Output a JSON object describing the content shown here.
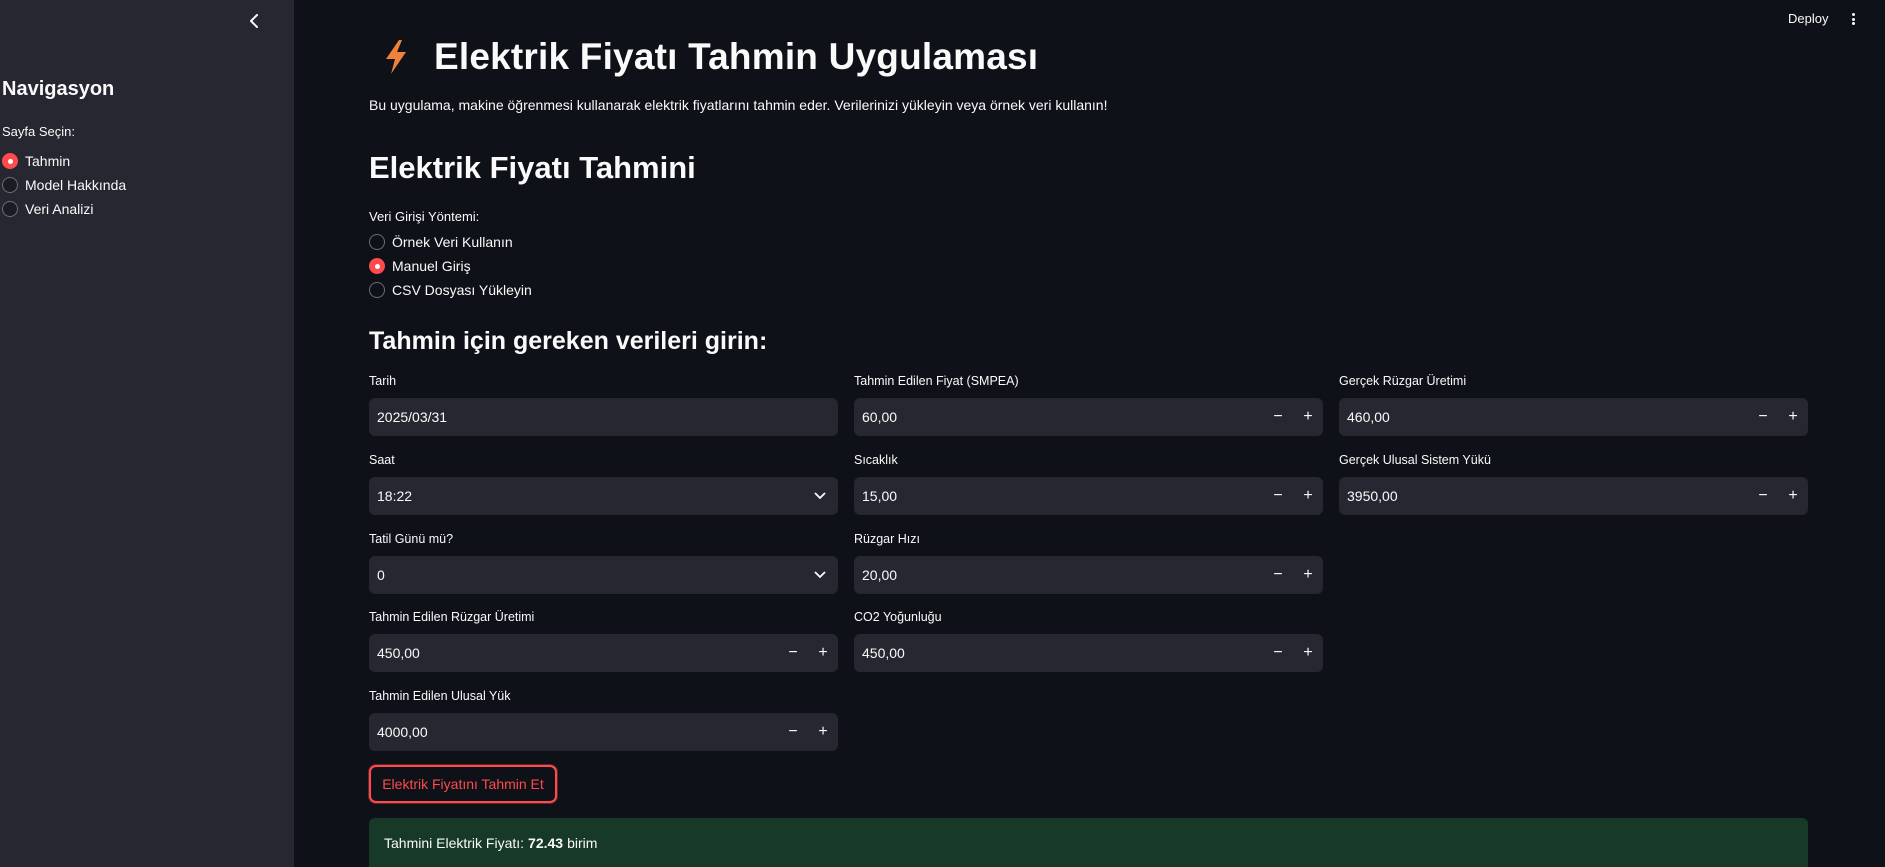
{
  "header": {
    "deploy_label": "Deploy",
    "menu_icon": "kebab-menu-icon"
  },
  "sidebar": {
    "title": "Navigasyon",
    "page_label": "Sayfa Seçin:",
    "items": [
      {
        "label": "Tahmin",
        "selected": true
      },
      {
        "label": "Model Hakkında",
        "selected": false
      },
      {
        "label": "Veri Analizi",
        "selected": false
      }
    ]
  },
  "main": {
    "title": "Elektrik Fiyatı Tahmin Uygulaması",
    "title_icon": "lightning-bolt-icon",
    "intro": "Bu uygulama, makine öğrenmesi kullanarak elektrik fiyatlarını tahmin eder. Verilerinizi yükleyin veya örnek veri kullanın!",
    "section_title": "Elektrik Fiyatı Tahmini",
    "method_label": "Veri Girişi Yöntemi:",
    "methods": [
      {
        "label": "Örnek Veri Kullanın",
        "selected": false
      },
      {
        "label": "Manuel Giriş",
        "selected": true
      },
      {
        "label": "CSV Dosyası Yükleyin",
        "selected": false
      }
    ],
    "inputs_title": "Tahmin için gereken verileri girin:",
    "fields": {
      "tarih": {
        "label": "Tarih",
        "value": "2025/03/31"
      },
      "saat": {
        "label": "Saat",
        "value": "18:22"
      },
      "tatil": {
        "label": "Tatil Günü mü?",
        "value": "0"
      },
      "tahmin_ruzgar": {
        "label": "Tahmin Edilen Rüzgar Üretimi",
        "value": "450,00"
      },
      "tahmin_yuk": {
        "label": "Tahmin Edilen Ulusal Yük",
        "value": "4000,00"
      },
      "smpea": {
        "label": "Tahmin Edilen Fiyat (SMPEA)",
        "value": "60,00"
      },
      "sicaklik": {
        "label": "Sıcaklık",
        "value": "15,00"
      },
      "ruzgar_hizi": {
        "label": "Rüzgar Hızı",
        "value": "20,00"
      },
      "co2": {
        "label": "CO2 Yoğunluğu",
        "value": "450,00"
      },
      "gercek_ruzgar": {
        "label": "Gerçek Rüzgar Üretimi",
        "value": "460,00"
      },
      "gercek_yuk": {
        "label": "Gerçek Ulusal Sistem Yükü",
        "value": "3950,00"
      }
    },
    "stepper": {
      "minus": "−",
      "plus": "+"
    },
    "predict_button": "Elektrik Fiyatını Tahmin Et",
    "result": {
      "prefix": "Tahmini Elektrik Fiyatı:",
      "value": "72.43",
      "unit": "birim"
    }
  },
  "colors": {
    "accent": "#ff4b4b",
    "background": "#0e1117",
    "sidebar": "#262730",
    "success_bg": "#173928",
    "bolt": "#f0813a"
  }
}
